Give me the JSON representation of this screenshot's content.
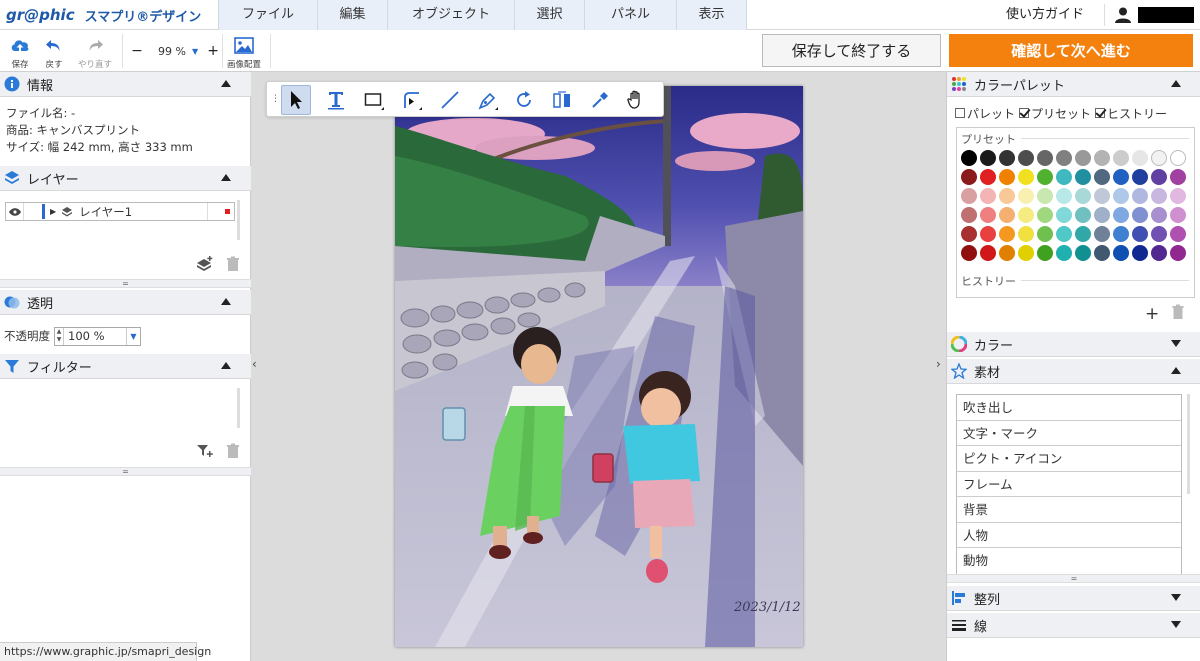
{
  "app": {
    "brand": "gr@phic",
    "product": "スマプリ®デザイン"
  },
  "menu": [
    {
      "label": "ファイル",
      "w": 99
    },
    {
      "label": "編集",
      "w": 70
    },
    {
      "label": "オブジェクト",
      "w": 127
    },
    {
      "label": "選択",
      "w": 70
    },
    {
      "label": "パネル",
      "w": 92
    },
    {
      "label": "表示",
      "w": 71
    }
  ],
  "header": {
    "guide": "使い方ガイド"
  },
  "toolbar": {
    "save": "保存",
    "undo": "戻す",
    "redo": "やり直す",
    "zoom_value": "99 %",
    "zoom_minus": "−",
    "zoom_plus": "+",
    "image_layout": "画像配置",
    "save_exit": "保存して終了する",
    "confirm_next": "確認して次へ進む"
  },
  "panels": {
    "info": {
      "title": "情報",
      "file_name": "ファイル名:  -",
      "product": "商品:  キャンバスプリント",
      "size": "サイズ:  幅 242 mm,  高さ 333 mm"
    },
    "layers": {
      "title": "レイヤー",
      "items": [
        "レイヤー1"
      ]
    },
    "transparency": {
      "title": "透明",
      "label": "不透明度",
      "value": "100 %"
    },
    "filter": {
      "title": "フィルター"
    }
  },
  "status": {
    "url": "https://www.graphic.jp/smapri_design"
  },
  "canvas": {
    "date_text": "2023/1/12"
  },
  "right": {
    "palette": {
      "title": "カラーパレット",
      "opt_palette": "パレット",
      "opt_preset": "プリセット",
      "opt_history": "ヒストリー",
      "preset_label": "プリセット",
      "history_label": "ヒストリー",
      "add": "+"
    },
    "color": {
      "title": "カラー"
    },
    "material": {
      "title": "素材",
      "items": [
        "吹き出し",
        "文字・マーク",
        "ピクト・アイコン",
        "フレーム",
        "背景",
        "人物",
        "動物"
      ]
    },
    "align": {
      "title": "整列"
    },
    "line": {
      "title": "線"
    }
  },
  "colors": {
    "accent_blue": "#1e5aa8",
    "confirm_orange": "#f4800d",
    "swatches": [
      [
        "#000000",
        "#1a1a1a",
        "#333333",
        "#4d4d4d",
        "#666666",
        "#808080",
        "#999999",
        "#b3b3b3",
        "#cccccc",
        "#e6e6e6",
        "#f2f2f2",
        "#ffffff"
      ],
      [
        "#8b1a1a",
        "#e02020",
        "#f08000",
        "#f0e020",
        "#50b030",
        "#40b8c0",
        "#2090a0",
        "#506880",
        "#2060c0",
        "#2040a0",
        "#6040a0",
        "#a040a0"
      ],
      [
        "#d8a0a0",
        "#f4b4b4",
        "#f8c898",
        "#f8f0b0",
        "#c8e8b0",
        "#b8e8e8",
        "#a8d8d8",
        "#c0c8d8",
        "#b0c8e8",
        "#b0b8e0",
        "#c8b8e0",
        "#e0b8e0"
      ],
      [
        "#c07070",
        "#f08080",
        "#f4b070",
        "#f4ec80",
        "#a0d880",
        "#80d8d8",
        "#70c0c0",
        "#a0b0c8",
        "#80a8e0",
        "#8090d0",
        "#a890d0",
        "#d090d0"
      ],
      [
        "#a83030",
        "#e84040",
        "#f49820",
        "#f0e040",
        "#70c050",
        "#50c8c8",
        "#30a8a8",
        "#708098",
        "#4080d0",
        "#4050b0",
        "#7050b0",
        "#b050b0"
      ],
      [
        "#901010",
        "#d01818",
        "#e08000",
        "#e0d000",
        "#40a020",
        "#20b0b0",
        "#109090",
        "#405870",
        "#1050b0",
        "#102890",
        "#502890",
        "#902890"
      ]
    ]
  }
}
